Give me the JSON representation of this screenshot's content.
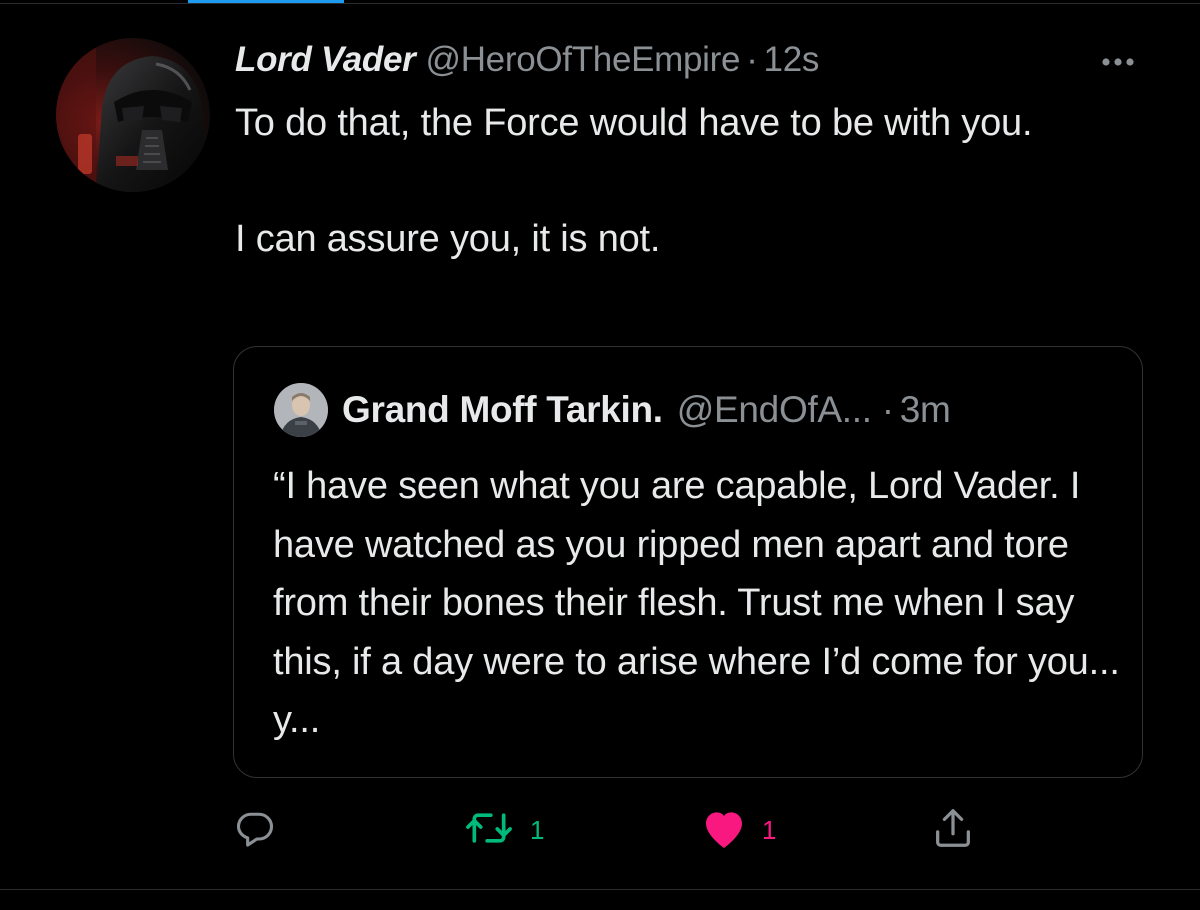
{
  "tweet": {
    "display_name": "Lord Vader",
    "handle": "@HeroOfTheEmpire",
    "separator": "·",
    "timestamp": "12s",
    "text": "To do that, the Force would have to be with you.\n\nI can assure you, it is not.",
    "more_icon": "more-horizontal-icon"
  },
  "quoted_tweet": {
    "display_name": "Grand Moff Tarkin.",
    "handle": "@EndOfA...",
    "separator": "·",
    "timestamp": "3m",
    "text": "“I have seen what you are capable, Lord Vader. I have watched as you ripped men apart and tore from their bones their flesh. Trust me when I say this, if a day were to arise where I’d come for you... y..."
  },
  "actions": {
    "reply": {
      "icon": "reply-icon",
      "count": ""
    },
    "retweet": {
      "icon": "retweet-icon",
      "count": "1",
      "color": "#00ba7c"
    },
    "like": {
      "icon": "heart-filled-icon",
      "count": "1",
      "color": "#f91880"
    },
    "share": {
      "icon": "share-icon",
      "count": ""
    }
  },
  "colors": {
    "background": "#000000",
    "text_primary": "#e7e9ea",
    "text_secondary": "#8b9095",
    "accent": "#1d9bf0",
    "border": "#2f3336"
  }
}
